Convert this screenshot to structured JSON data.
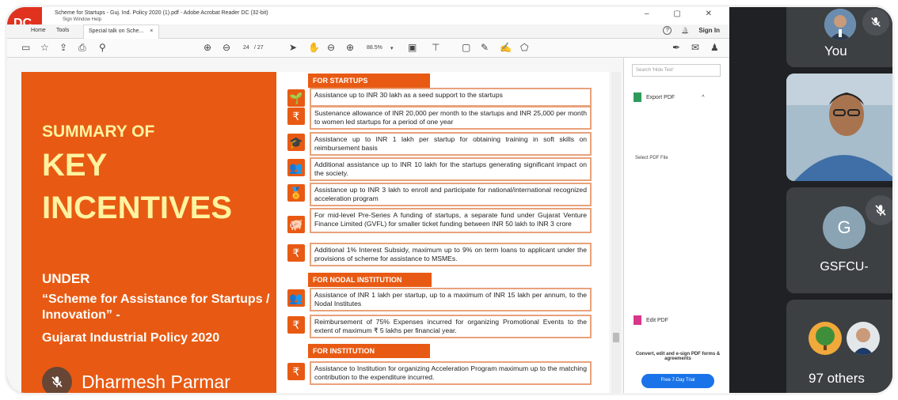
{
  "window": {
    "title": "Scheme for Startups - Guj. Ind. Policy 2020 (1).pdf - Adobe Acrobat Reader DC (32-bit)",
    "menu": "Sign   Window   Help",
    "controls": "–  ▢  ✕",
    "logo_text": "DC"
  },
  "tabs": {
    "home": "Home",
    "tools": "Tools",
    "active": "Special talk on Sche...",
    "close": "×",
    "help": "?",
    "bell": "🔔",
    "signin": "Sign In"
  },
  "toolbar": {
    "page_current": "24",
    "page_total": "/ 27",
    "zoom": "88.5%",
    "zoom_caret": "▾"
  },
  "slide_left": {
    "line1": "SUMMARY OF",
    "line2": "KEY",
    "line3": "INCENTIVES",
    "line4": "UNDER",
    "line5": "“Scheme for Assistance for Startups / Innovation” -",
    "line6": "Gujarat Industrial Policy 2020"
  },
  "presenter": {
    "name": "Dharmesh Parmar"
  },
  "slide_right": {
    "sections": [
      {
        "label": "FOR STARTUPS"
      },
      {
        "label": "FOR NODAL INSTITUTION"
      },
      {
        "label": "FOR INSTITUTION"
      }
    ],
    "rows": [
      {
        "icon": "🌱",
        "text": "Assistance up to INR 30 lakh as a seed support to the startups"
      },
      {
        "icon": "₹",
        "text": "Sustenance allowance of INR 20,000 per month to the startups and INR 25,000 per month to women led startups for a period of one year"
      },
      {
        "icon": "🎓",
        "text": "Assistance up to INR 1 lakh per startup for obtaining training in soft skills on reimbursement basis"
      },
      {
        "icon": "👥",
        "text": "Additional assistance up to INR 10 lakh for the startups generating significant impact on the society."
      },
      {
        "icon": "🏅",
        "text": "Assistance up to INR 3 lakh to enroll and participate for national/international recognized acceleration program"
      },
      {
        "icon": "🐖",
        "text": "For mid-level Pre-Series A funding of startups, a separate fund under Gujarat Venture Finance Limited (GVFL) for smaller ticket funding between INR 50 lakh to INR 3 crore"
      },
      {
        "icon": "₹",
        "text": "Additional 1% Interest Subsidy, maximum up to 9% on term loans to applicant under the provisions of scheme for assistance to MSMEs."
      },
      {
        "icon": "👥",
        "text": "Assistance of INR 1 lakh per startup, up to a maximum of INR 15 lakh per annum, to the Nodal Institutes"
      },
      {
        "icon": "₹",
        "text": "Reimbursement of 75% Expenses incurred for organizing Promotional Events to the extent of maximum ₹ 5 lakhs per financial year."
      },
      {
        "icon": "₹",
        "text": "Assistance to Institution for organizing Acceleration Program maximum up to the matching contribution to the expenditure incurred."
      }
    ]
  },
  "pane": {
    "search_placeholder": "Search 'Hide Text'",
    "export_pdf": "Export PDF",
    "caret": "^",
    "select_pdf": "Select PDF File",
    "edit_pdf": "Edit PDF",
    "promo": "Convert, edit and e-sign PDF forms & agreements",
    "trial": "Free 7-Day Trial"
  },
  "participants": {
    "you_label": "You",
    "g_initial": "G",
    "g_label": "GSFCU-",
    "others_label": "97 others"
  },
  "colors": {
    "accent_orange": "#e85a13",
    "title_yellow": "#fff3a0",
    "meet_dark": "#202124"
  }
}
